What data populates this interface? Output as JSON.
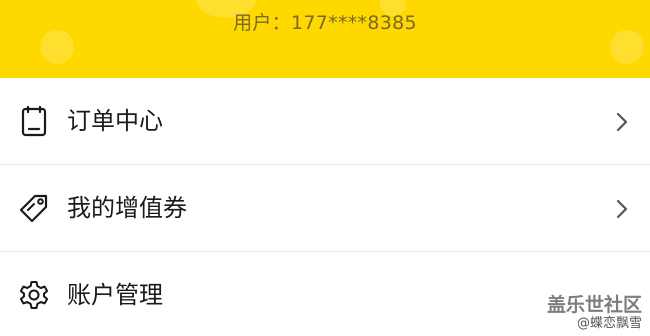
{
  "header": {
    "user_text": "用户：177****8385",
    "background_color": "#ffd800"
  },
  "menu": {
    "items": [
      {
        "label": "订单中心",
        "icon": "clipboard-icon"
      },
      {
        "label": "我的增值券",
        "icon": "tag-icon"
      },
      {
        "label": "账户管理",
        "icon": "gear-icon"
      }
    ]
  },
  "watermark": {
    "title": "盖乐世社区",
    "user": "@蝶恋飘雪"
  }
}
